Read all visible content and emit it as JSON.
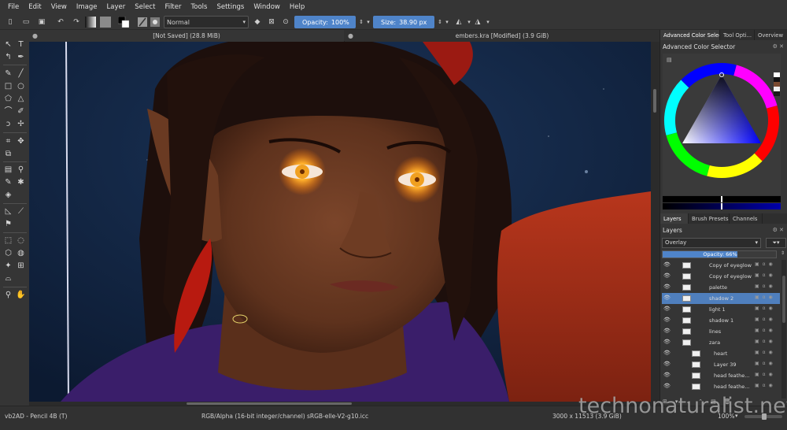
{
  "menubar": {
    "items": [
      "File",
      "Edit",
      "View",
      "Image",
      "Layer",
      "Select",
      "Filter",
      "Tools",
      "Settings",
      "Window",
      "Help"
    ]
  },
  "toolbar": {
    "blend_mode": "Normal",
    "opacity_label": "Opacity:",
    "opacity_value": "100%",
    "size_label": "Size:",
    "size_value": "38.90 px"
  },
  "canvas_tabs": [
    {
      "label": "[Not Saved]  (28.8 MiB)"
    },
    {
      "label": "embers.kra [Modified]  (3.9 GiB)"
    }
  ],
  "docker": {
    "top_tabs": [
      "Advanced Color Selec...",
      "Tool Opti...",
      "Overview"
    ],
    "color_selector_title": "Advanced Color Selector",
    "mid_tabs": [
      "Layers",
      "Brush Presets",
      "Channels"
    ],
    "layers_title": "Layers",
    "layers_blend_mode": "Overlay",
    "layers_opacity_label": "Opacity:",
    "layers_opacity_value": "66%",
    "layers": [
      {
        "name": "Copy of eyeglow ...",
        "selected": false
      },
      {
        "name": "Copy of eyeglow ...",
        "selected": false
      },
      {
        "name": "palette",
        "selected": false
      },
      {
        "name": "shadow 2",
        "selected": true
      },
      {
        "name": "light 1",
        "selected": false
      },
      {
        "name": "shadow 1",
        "selected": false
      },
      {
        "name": "lines",
        "selected": false
      },
      {
        "name": "zara",
        "selected": false
      },
      {
        "name": "heart",
        "selected": false
      },
      {
        "name": "Layer 39",
        "selected": false
      },
      {
        "name": "head feathe...",
        "selected": false
      },
      {
        "name": "head feathe...",
        "selected": false
      }
    ]
  },
  "statusbar": {
    "brush": "vb2AD - Pencil 4B (T)",
    "color_model": "RGB/Alpha (16-bit integer/channel)",
    "profile": "sRGB-elle-V2-g10.icc",
    "dimensions": "3000 x 11513 (3.9 GiB)",
    "zoom": "100%"
  },
  "watermark": "technonaturalist.net"
}
